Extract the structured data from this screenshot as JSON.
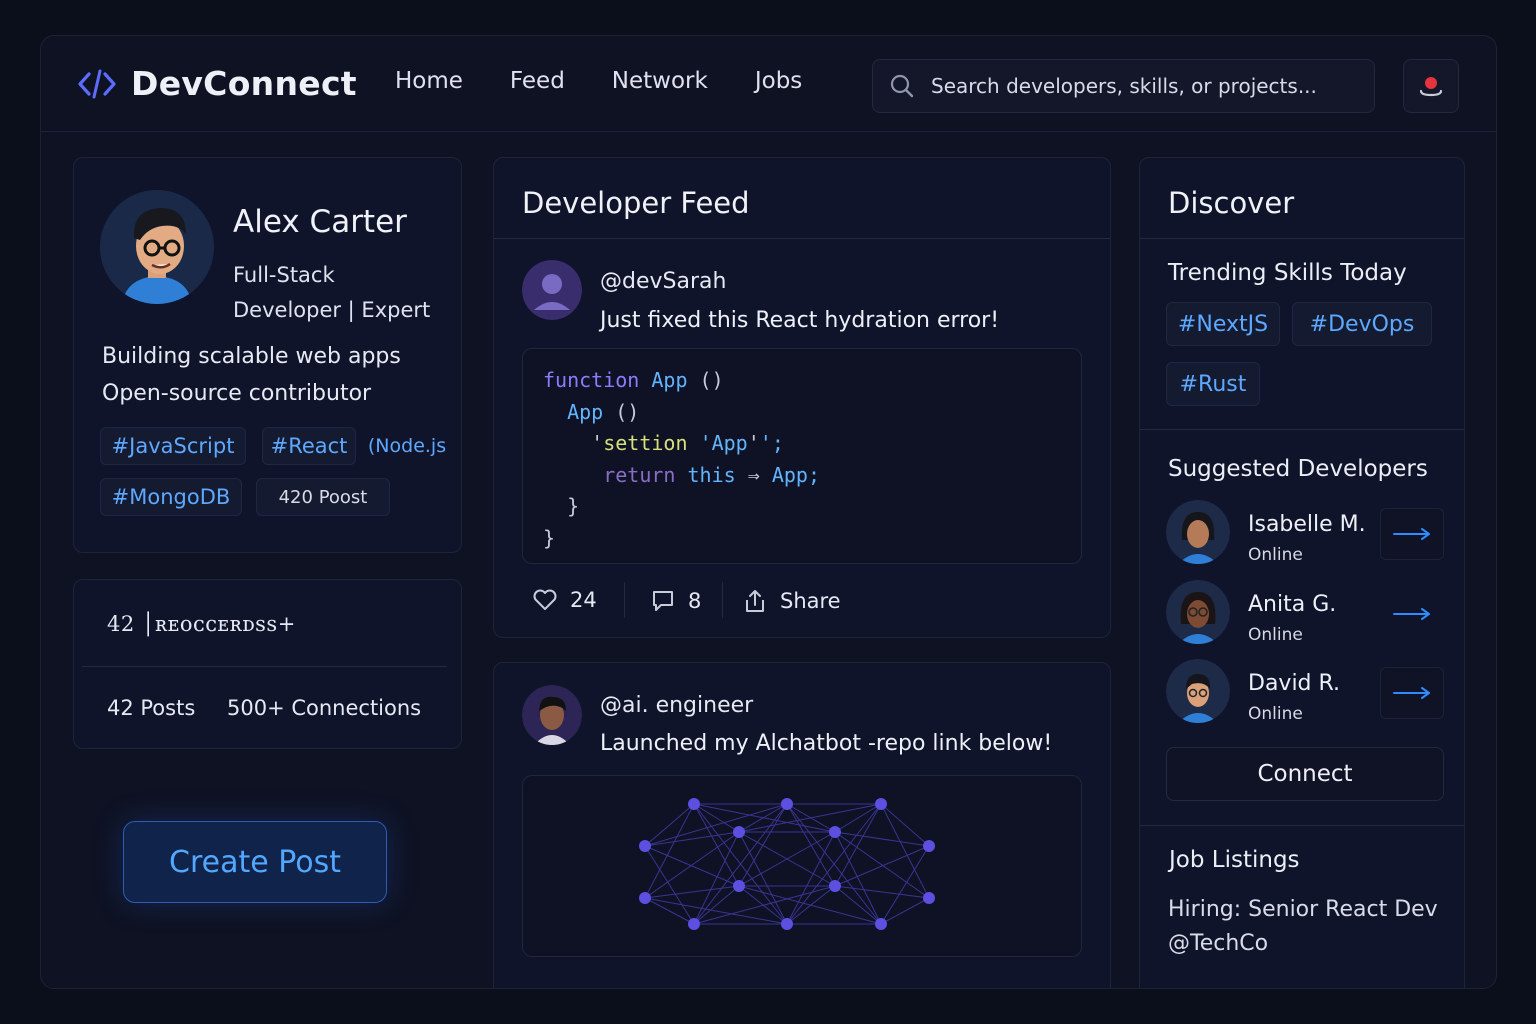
{
  "app": {
    "name": "DevConnect",
    "accent": "#5b6cff"
  },
  "nav": {
    "items": [
      "Home",
      "Feed",
      "Network",
      "Jobs"
    ]
  },
  "search": {
    "placeholder": "Search developers, skills, or projects..."
  },
  "profile": {
    "name": "Alex Carter",
    "role_line1": "Full-Stack",
    "role_line2": "Developer | Expert",
    "bio_line1": "Building scalable web apps",
    "bio_line2": "Open-source contributor",
    "tags": [
      "#JavaScript",
      "#React",
      "(Node.js",
      "#MongoDB"
    ],
    "posts_tag": "420 Poost"
  },
  "stats": {
    "line1": "42 │ʀᴇᴏᴄᴄᴇʀᴅѕѕ+",
    "posts": "42 Posts",
    "connections": "500+ Connections"
  },
  "actions": {
    "create_post": "Create Post"
  },
  "feed": {
    "title": "Developer Feed",
    "post1": {
      "user": "@devSarah",
      "text": "Just fixed this React hydration error!",
      "likes": "24",
      "comments": "8",
      "share": "Share"
    },
    "post2": {
      "user": "@ai. engineer",
      "text": "Launched my Alchatbot -repo link below!"
    }
  },
  "discover": {
    "title": "Discover",
    "trending_title": "Trending Skills Today",
    "trending_tags": [
      "#NextJS",
      "#DevOps",
      "#Rust"
    ],
    "suggested_title": "Suggested Developers",
    "developers": [
      {
        "name": "Isabelle M.",
        "status": "Online"
      },
      {
        "name": "Anita G.",
        "status": "Online"
      },
      {
        "name": "David R.",
        "status": "Online"
      }
    ],
    "connect_label": "Connect",
    "jobs_title": "Job Listings",
    "job_line1": "Hiring: Senior React Dev",
    "job_line2": "@TechCo"
  }
}
